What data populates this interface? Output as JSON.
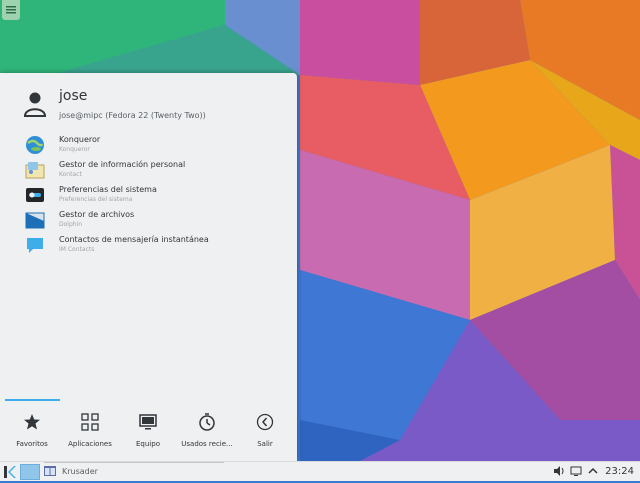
{
  "menu": {
    "user_name": "jose",
    "user_host": "jose@mipc (Fedora 22 (Twenty Two))",
    "favorites": [
      {
        "title": "Konqueror",
        "subtitle": "Konqueror",
        "icon": "globe-icon"
      },
      {
        "title": "Gestor de información personal",
        "subtitle": "Kontact",
        "icon": "kontact-icon"
      },
      {
        "title": "Preferencias del sistema",
        "subtitle": "Preferencias del sistema",
        "icon": "settings-toggle-icon"
      },
      {
        "title": "Gestor de archivos",
        "subtitle": "Dolphin",
        "icon": "folder-icon"
      },
      {
        "title": "Contactos de mensajería instantánea",
        "subtitle": "IM Contacts",
        "icon": "chat-icon"
      }
    ],
    "tabs": [
      {
        "label": "Favoritos",
        "icon": "star-icon"
      },
      {
        "label": "Aplicaciones",
        "icon": "grid-icon"
      },
      {
        "label": "Equipo",
        "icon": "monitor-icon"
      },
      {
        "label": "Usados recie...",
        "icon": "clock-icon"
      },
      {
        "label": "Salir",
        "icon": "left-arrow-circle-icon"
      }
    ]
  },
  "taskbar": {
    "task_label": "Krusader",
    "clock": "23:24"
  },
  "colors": {
    "accent": "#3daee9",
    "menu_bg": "#eff0f1",
    "text": "#31363b"
  }
}
